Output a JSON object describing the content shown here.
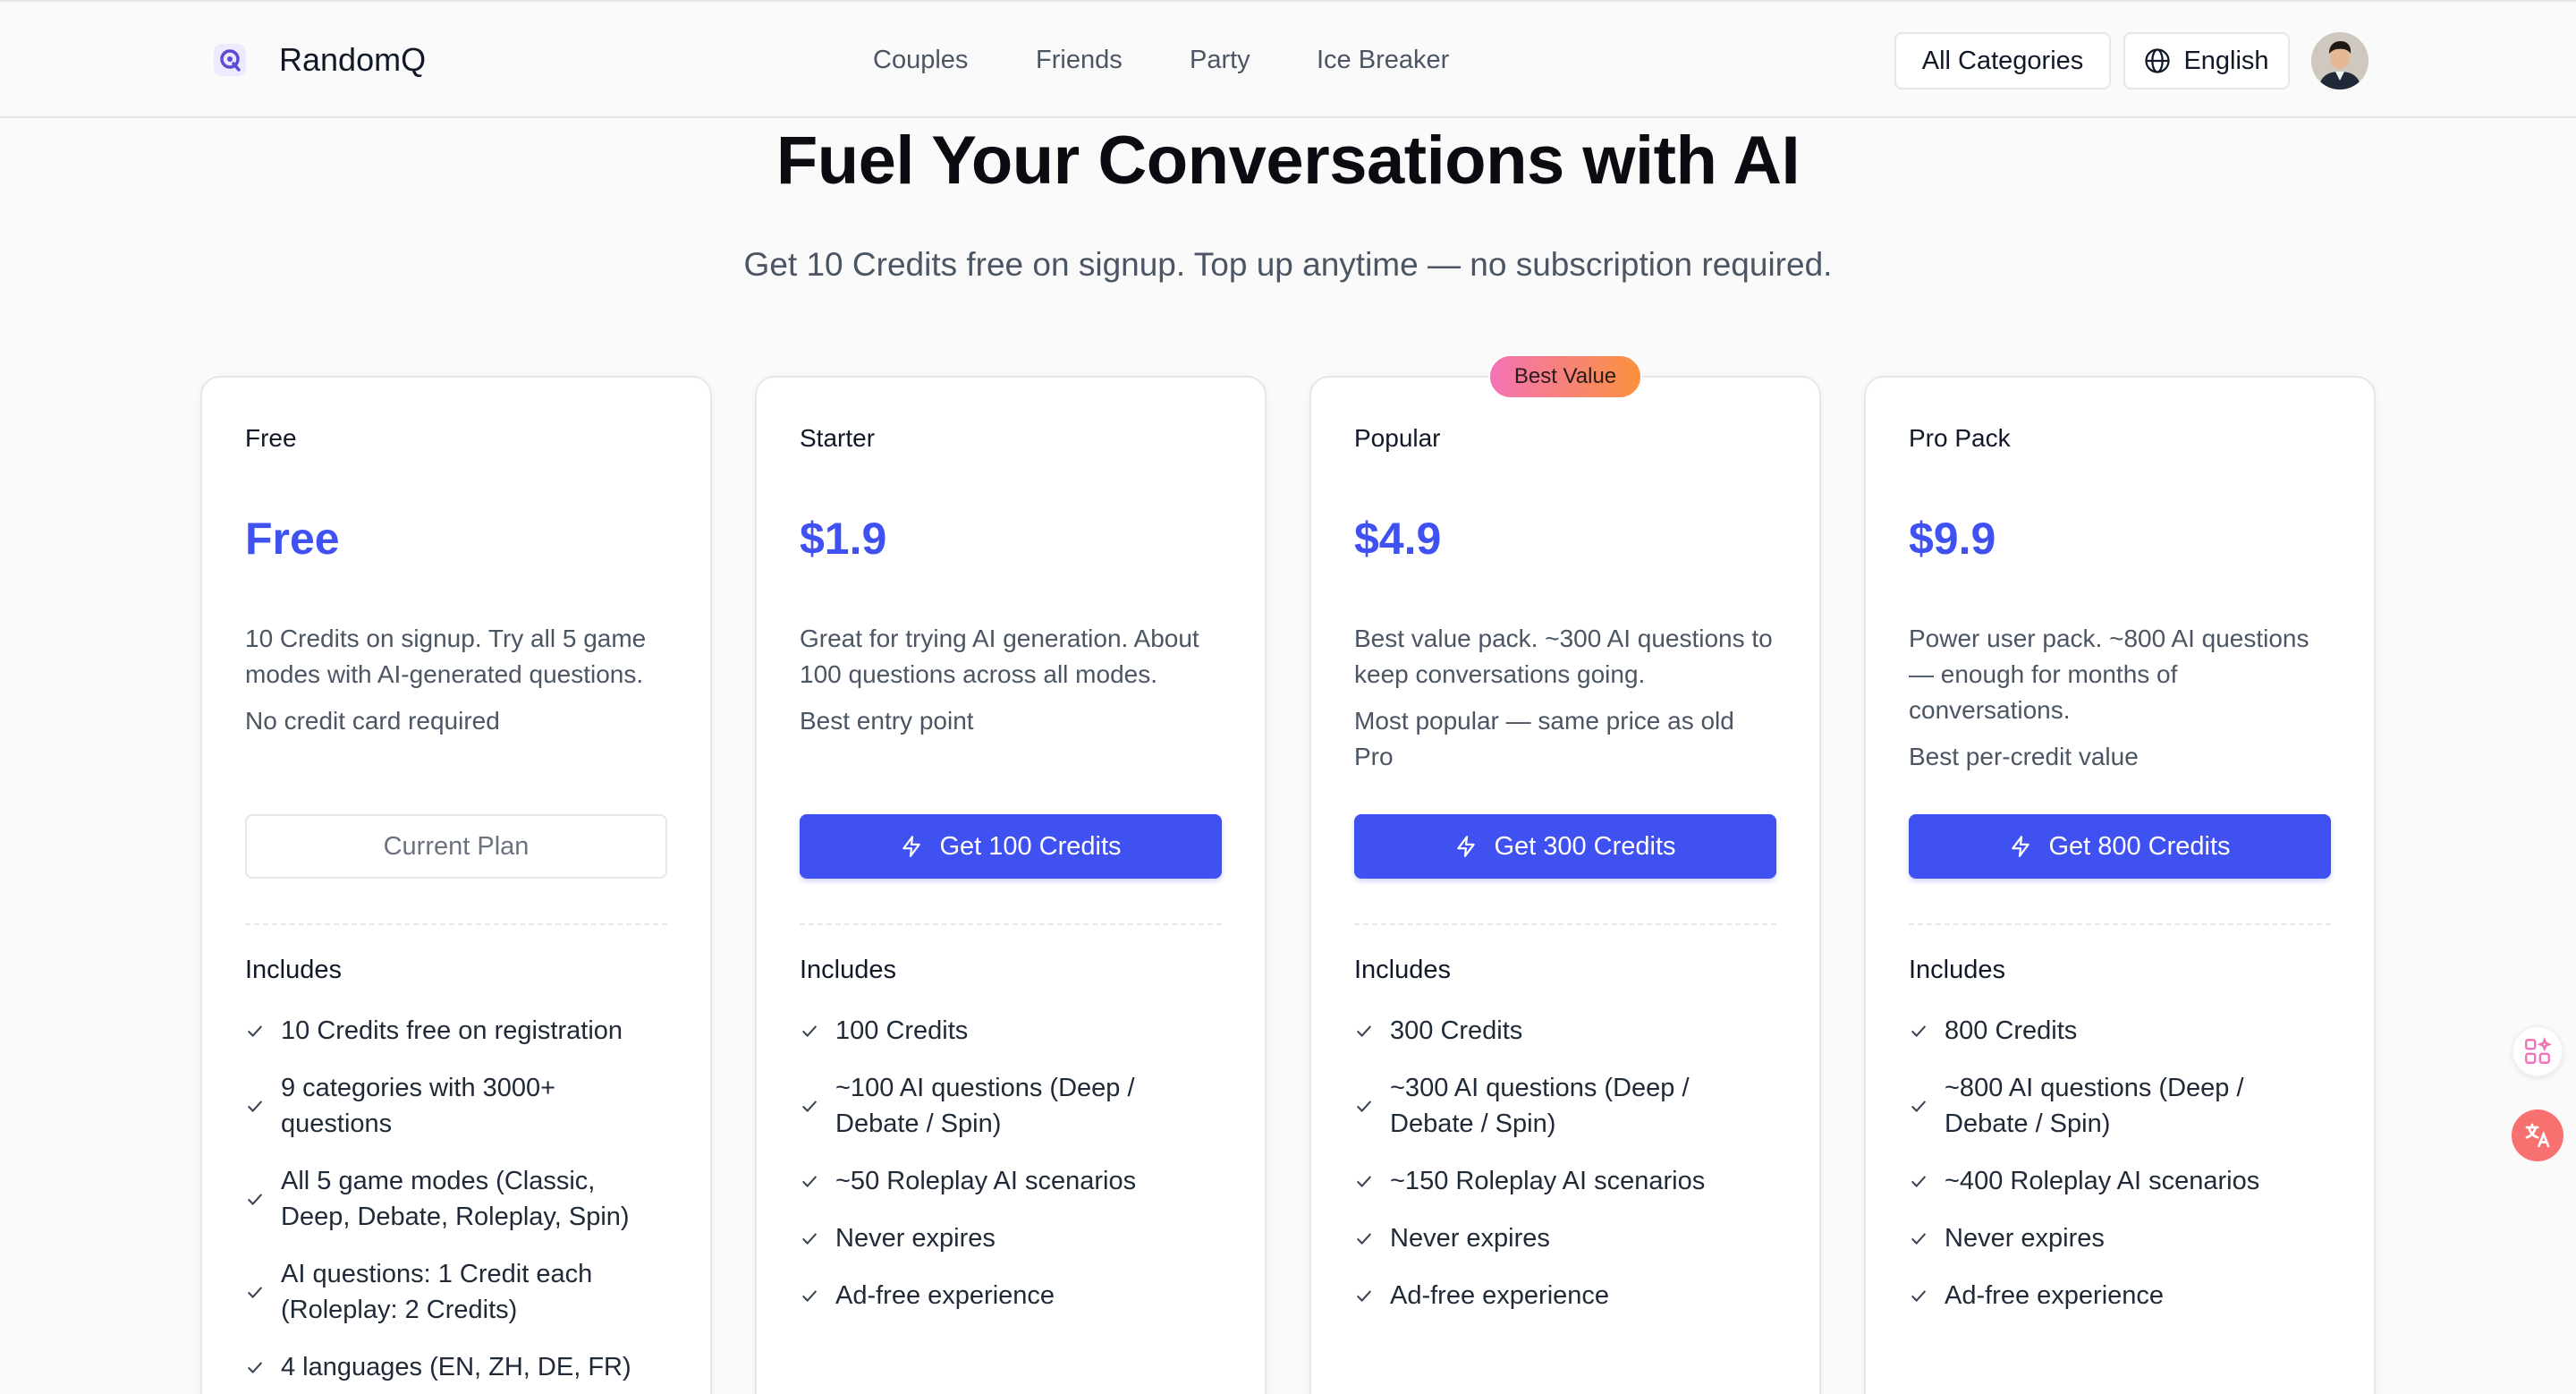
{
  "header": {
    "brand": "RandomQ",
    "logo_icon": "question-logo-icon",
    "nav": [
      "Couples",
      "Friends",
      "Party",
      "Ice Breaker"
    ],
    "categories_button": "All Categories",
    "language_button": "English",
    "language_icon": "globe-icon",
    "avatar_icon": "user-avatar"
  },
  "hero": {
    "title": "Fuel Your Conversations with AI",
    "subtitle": "Get 10 Credits free on signup. Top up anytime — no subscription required."
  },
  "colors": {
    "accent": "#3f51f0",
    "badge_gradient_start": "#f472b6",
    "badge_gradient_end": "#fb923c"
  },
  "plans": [
    {
      "name": "Free",
      "price": "Free",
      "description": "10 Credits on signup. Try all 5 game modes with AI-generated questions.",
      "note": "No credit card required",
      "button": "Current Plan",
      "includes_title": "Includes",
      "features": [
        "10 Credits free on registration",
        "9 categories with 3000+ questions",
        "All 5 game modes (Classic, Deep, Debate, Roleplay, Spin)",
        "AI questions: 1 Credit each (Roleplay: 2 Credits)",
        "4 languages (EN, ZH, DE, FR)"
      ]
    },
    {
      "name": "Starter",
      "price": "$1.9",
      "description": "Great for trying AI generation. About 100 questions across all modes.",
      "note": "Best entry point",
      "button": "Get 100 Credits",
      "includes_title": "Includes",
      "features": [
        "100 Credits",
        "~100 AI questions (Deep / Debate / Spin)",
        "~50 Roleplay AI scenarios",
        "Never expires",
        "Ad-free experience"
      ]
    },
    {
      "name": "Popular",
      "price": "$4.9",
      "badge": "Best Value",
      "description": "Best value pack. ~300 AI questions to keep conversations going.",
      "note": "Most popular — same price as old Pro",
      "button": "Get 300 Credits",
      "includes_title": "Includes",
      "features": [
        "300 Credits",
        "~300 AI questions (Deep / Debate / Spin)",
        "~150 Roleplay AI scenarios",
        "Never expires",
        "Ad-free experience"
      ]
    },
    {
      "name": "Pro Pack",
      "price": "$9.9",
      "description": "Power user pack. ~800 AI questions — enough for months of conversations.",
      "note": "Best per-credit value",
      "button": "Get 800 Credits",
      "includes_title": "Includes",
      "features": [
        "800 Credits",
        "~800 AI questions (Deep / Debate / Spin)",
        "~400 Roleplay AI scenarios",
        "Never expires",
        "Ad-free experience"
      ]
    }
  ],
  "floating": {
    "apps_icon": "apps-sparkle-icon",
    "translate_icon": "translate-icon"
  }
}
